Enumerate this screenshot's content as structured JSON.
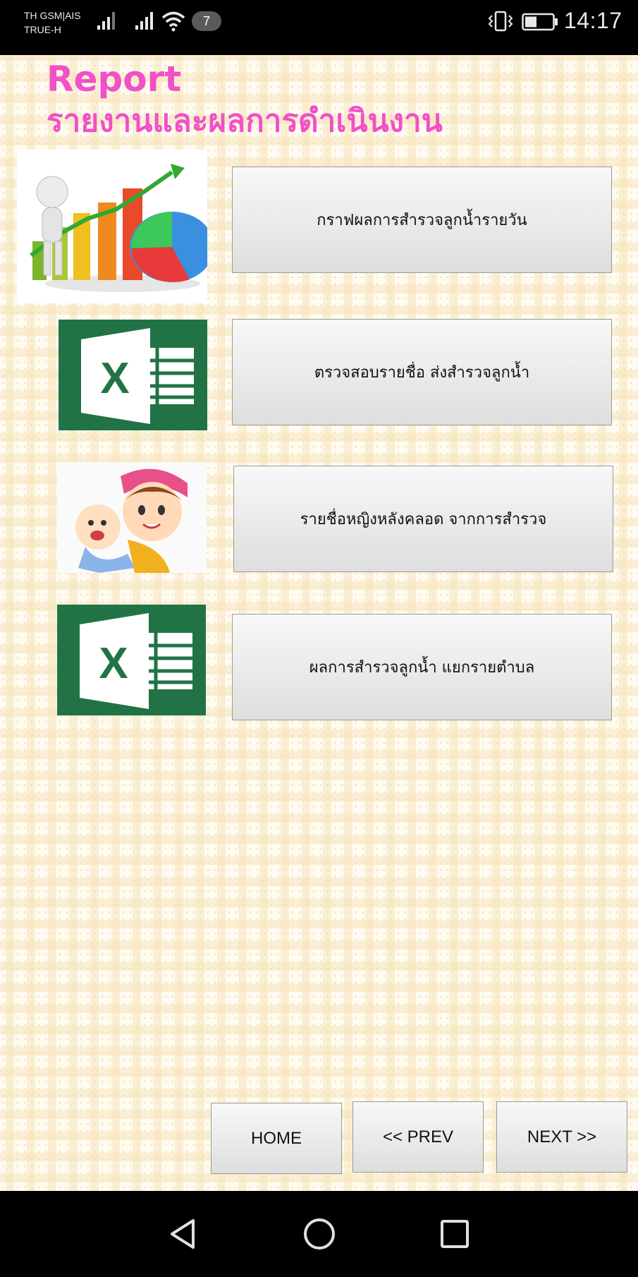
{
  "status_bar": {
    "carrier_line1": "TH GSM|AIS",
    "carrier_line2": "TRUE-H",
    "notification_count": "7",
    "time": "14:17",
    "icons": [
      "signal-icon",
      "signal-icon",
      "wifi-icon",
      "vibrate-icon",
      "battery-icon"
    ]
  },
  "header": {
    "title_en": "Report",
    "title_th": "รายงานและผลการดำเนินงาน"
  },
  "menu": [
    {
      "label": "กราฟผลการสำรวจลูกน้ำรายวัน",
      "image": "chart-graphic"
    },
    {
      "label": "ตรวจสอบรายชื่อ ส่งสำรวจลูกน้ำ",
      "image": "excel-icon"
    },
    {
      "label": "รายชื่อหญิงหลังคลอด จากการสำรวจ",
      "image": "mother-baby-cartoon"
    },
    {
      "label": "ผลการสำรวจลูกน้ำ แยกรายตำบล",
      "image": "excel-icon"
    }
  ],
  "footer": {
    "home_label": "HOME",
    "prev_label": "<< PREV",
    "next_label": "NEXT  >>"
  },
  "colors": {
    "title": "#f050c8",
    "excel_green": "#217346",
    "background": "#fffbf1"
  },
  "system_nav": {
    "icons": [
      "back-icon",
      "home-circle-icon",
      "recents-square-icon"
    ]
  }
}
